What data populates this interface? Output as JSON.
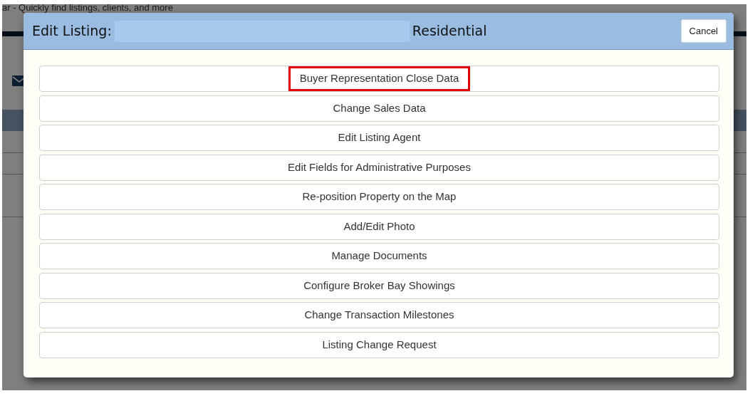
{
  "background": {
    "search_hint": "ar - Quickly find listings, clients, and more"
  },
  "dialog": {
    "title": "Edit Listing:",
    "subtitle": "Residential",
    "cancel": "Cancel",
    "actions": [
      {
        "label": "Buyer Representation Close Data",
        "highlighted": true
      },
      {
        "label": "Change Sales Data",
        "highlighted": false
      },
      {
        "label": "Edit Listing Agent",
        "highlighted": false
      },
      {
        "label": "Edit Fields for Administrative Purposes",
        "highlighted": false
      },
      {
        "label": "Re-position Property on the Map",
        "highlighted": false
      },
      {
        "label": "Add/Edit Photo",
        "highlighted": false
      },
      {
        "label": "Manage Documents",
        "highlighted": false
      },
      {
        "label": "Configure Broker Bay Showings",
        "highlighted": false
      },
      {
        "label": "Change Transaction Milestones",
        "highlighted": false
      },
      {
        "label": "Listing Change Request",
        "highlighted": false
      }
    ]
  }
}
